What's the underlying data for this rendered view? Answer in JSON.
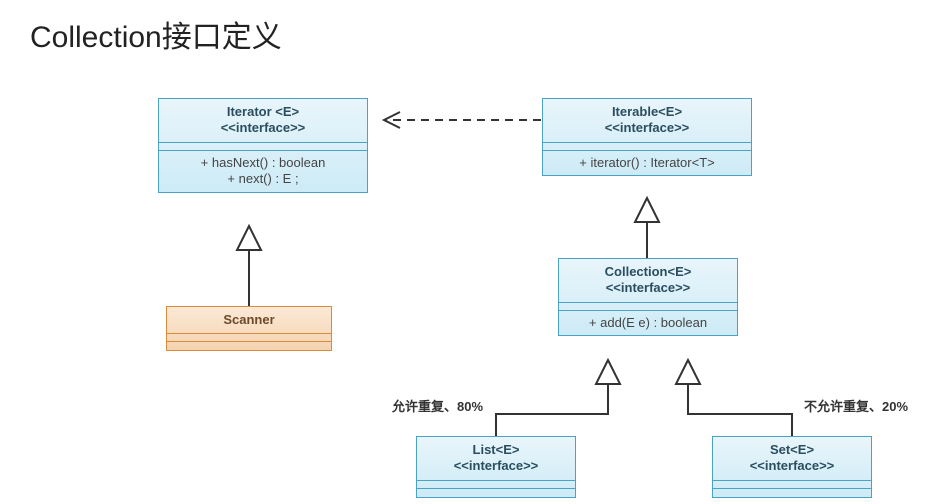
{
  "title": "Collection接口定义",
  "iterator": {
    "name": "Iterator <E>",
    "stereo": "<<interface>>",
    "methods": "+ hasNext() : boolean\n+ next() : E ;"
  },
  "iterable": {
    "name": "Iterable<E>",
    "stereo": "<<interface>>",
    "methods": "+ iterator() : Iterator<T>"
  },
  "scanner": {
    "name": "Scanner"
  },
  "collection": {
    "name": "Collection<E>",
    "stereo": "<<interface>>",
    "methods": "+ add(E e) : boolean"
  },
  "list": {
    "name": "List<E>",
    "stereo": "<<interface>>"
  },
  "set": {
    "name": "Set<E>",
    "stereo": "<<interface>>"
  },
  "labels": {
    "allow_dup": "允许重复、80%",
    "no_dup": "不允许重复、20%"
  },
  "colors": {
    "blue_border": "#4aa3c7",
    "orange_border": "#d98b3a"
  }
}
